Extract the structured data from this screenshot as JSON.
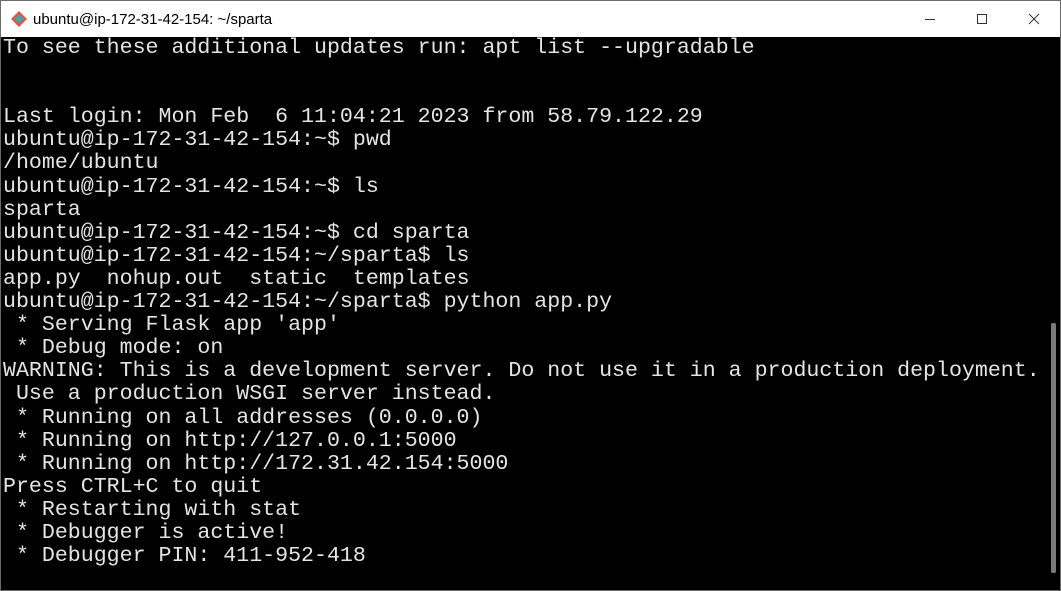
{
  "window": {
    "title": "ubuntu@ip-172-31-42-154: ~/sparta",
    "icon": "git-bash-diamond-icon"
  },
  "colors": {
    "default": "#e4e4e4",
    "directory": "#6f7bff",
    "warning": "#ff5a5a",
    "notice": "#d4aa20"
  },
  "terminal": {
    "lines": [
      {
        "segments": [
          {
            "text": "To see these additional updates run: apt list --upgradable",
            "color": "default"
          }
        ]
      },
      {
        "segments": [
          {
            "text": "",
            "color": "default"
          }
        ]
      },
      {
        "segments": [
          {
            "text": "",
            "color": "default"
          }
        ]
      },
      {
        "segments": [
          {
            "text": "Last login: Mon Feb  6 11:04:21 2023 from 58.79.122.29",
            "color": "default"
          }
        ]
      },
      {
        "segments": [
          {
            "text": "ubuntu@ip-172-31-42-154:~$ pwd",
            "color": "default"
          }
        ]
      },
      {
        "segments": [
          {
            "text": "/home/ubuntu",
            "color": "default"
          }
        ]
      },
      {
        "segments": [
          {
            "text": "ubuntu@ip-172-31-42-154:~$ ls",
            "color": "default"
          }
        ]
      },
      {
        "segments": [
          {
            "text": "sparta",
            "color": "directory"
          }
        ]
      },
      {
        "segments": [
          {
            "text": "ubuntu@ip-172-31-42-154:~$ cd sparta",
            "color": "default"
          }
        ]
      },
      {
        "segments": [
          {
            "text": "ubuntu@ip-172-31-42-154:~/sparta$ ls",
            "color": "default"
          }
        ]
      },
      {
        "segments": [
          {
            "text": "app.py  nohup.out  ",
            "color": "default"
          },
          {
            "text": "static",
            "color": "directory"
          },
          {
            "text": "  ",
            "color": "default"
          },
          {
            "text": "templates",
            "color": "directory"
          }
        ]
      },
      {
        "segments": [
          {
            "text": "ubuntu@ip-172-31-42-154:~/sparta$ python app.py",
            "color": "default"
          }
        ]
      },
      {
        "segments": [
          {
            "text": " * Serving Flask app 'app'",
            "color": "default"
          }
        ]
      },
      {
        "segments": [
          {
            "text": " * Debug mode: on",
            "color": "default"
          }
        ]
      },
      {
        "segments": [
          {
            "text": "WARNING: This is a development server. Do not use it in a production deployment.",
            "color": "warning"
          }
        ]
      },
      {
        "segments": [
          {
            "text": " Use a production WSGI server instead.",
            "color": "warning"
          }
        ]
      },
      {
        "segments": [
          {
            "text": " * Running on all addresses (0.0.0.0)",
            "color": "default"
          }
        ]
      },
      {
        "segments": [
          {
            "text": " * Running on http://127.0.0.1:5000",
            "color": "default"
          }
        ]
      },
      {
        "segments": [
          {
            "text": " * Running on http://172.31.42.154:5000",
            "color": "default"
          }
        ]
      },
      {
        "segments": [
          {
            "text": "Press CTRL+C to quit",
            "color": "notice"
          }
        ]
      },
      {
        "segments": [
          {
            "text": " * Restarting with stat",
            "color": "default"
          }
        ]
      },
      {
        "segments": [
          {
            "text": " * Debugger is active!",
            "color": "default"
          }
        ]
      },
      {
        "segments": [
          {
            "text": " * Debugger PIN: 411-952-418",
            "color": "default"
          }
        ]
      }
    ]
  }
}
